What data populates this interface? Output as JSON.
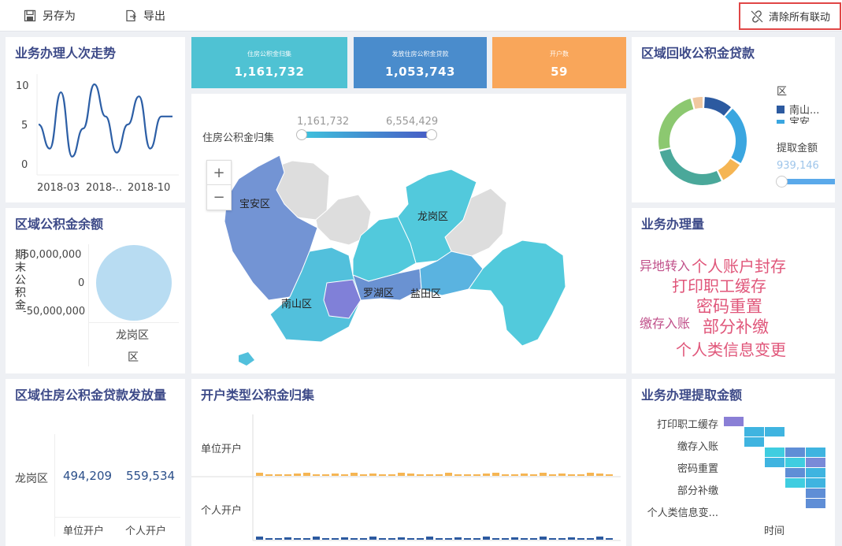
{
  "toolbar": {
    "save_as": "另存为",
    "export": "导出",
    "clear_links": "清除所有联动"
  },
  "trend": {
    "title": "业务办理人次走势",
    "y_ticks": [
      "10",
      "5",
      "0"
    ],
    "x_ticks": [
      "2018-03",
      "2018-..",
      "2018-10"
    ]
  },
  "kpis": [
    {
      "label": "住房公积金归集",
      "value": "1,161,732",
      "color": "#4fc2d3"
    },
    {
      "label": "发放住房公积金贷款",
      "value": "1,053,743",
      "color": "#4a8ccc"
    },
    {
      "label": "开户数",
      "value": "59",
      "color": "#f9a65a"
    }
  ],
  "map": {
    "legend_label": "住房公积金归集",
    "range_min": "1,161,732",
    "range_max": "6,554,429",
    "zoom_in": "+",
    "zoom_out": "−",
    "districts": {
      "baoan": "宝安区",
      "longgang": "龙岗区",
      "nanshan": "南山区",
      "luohu": "罗湖区",
      "yantian": "盐田区"
    }
  },
  "recovery": {
    "title": "区域回收公积金贷款",
    "legend_title": "区",
    "legend_items": [
      "南山...",
      "宝安"
    ],
    "size_title": "提取金额",
    "size_value": "939,146"
  },
  "balance": {
    "title": "区域公积金余额",
    "y_label": "期末公积金",
    "y_ticks": [
      "50,000,000",
      "0",
      "-50,000,000"
    ],
    "x_tick": "龙岗区",
    "x_title": "区"
  },
  "wordcloud": {
    "title": "业务办理量",
    "words": [
      {
        "text": "异地转入",
        "color": "#c0508a",
        "size": 16
      },
      {
        "text": "个人账户封存",
        "color": "#e0567a",
        "size": 20
      },
      {
        "text": "打印职工缓存",
        "color": "#e0567a",
        "size": 20
      },
      {
        "text": "密码重置",
        "color": "#e0567a",
        "size": 21
      },
      {
        "text": "缴存入账",
        "color": "#c0508a",
        "size": 16
      },
      {
        "text": "部分补缴",
        "color": "#e0567a",
        "size": 21
      },
      {
        "text": "个人类信息变更",
        "color": "#e0567a",
        "size": 20
      }
    ]
  },
  "loan_table": {
    "title": "区域住房公积金贷款发放量",
    "row_label": "龙岗区",
    "values": [
      "494,209",
      "559,534"
    ],
    "col_headers": [
      "单位开户",
      "个人开户"
    ]
  },
  "open_type": {
    "title": "开户类型公积金归集",
    "rows": [
      "单位开户",
      "个人开户"
    ]
  },
  "heatmap": {
    "title": "业务办理提取金额",
    "rows": [
      "打印职工缓存",
      "缴存入账",
      "密码重置",
      "部分补缴",
      "个人类信息变..."
    ],
    "x_title": "时间"
  },
  "chart_data": [
    {
      "type": "line",
      "title": "业务办理人次走势",
      "x": [
        "2018-03",
        "2018-..",
        "2018-10"
      ],
      "ylim": [
        0,
        10
      ],
      "series": [
        {
          "values": [
            5,
            2,
            9,
            1,
            4.5,
            10,
            6,
            1.5,
            5,
            8.5,
            2,
            6,
            6
          ]
        }
      ]
    },
    {
      "type": "pie",
      "title": "区域回收公积金贷款",
      "slices": [
        {
          "label": "南山...",
          "value": 10,
          "color": "#2c5aa0"
        },
        {
          "label": "宝安",
          "value": 20,
          "color": "#3aa6e0"
        },
        {
          "value": 8,
          "color": "#f5b553"
        },
        {
          "value": 26,
          "color": "#4aa89a"
        },
        {
          "value": 22,
          "color": "#8cc870"
        },
        {
          "value": 4,
          "color": "#f0c8a0"
        }
      ]
    }
  ]
}
